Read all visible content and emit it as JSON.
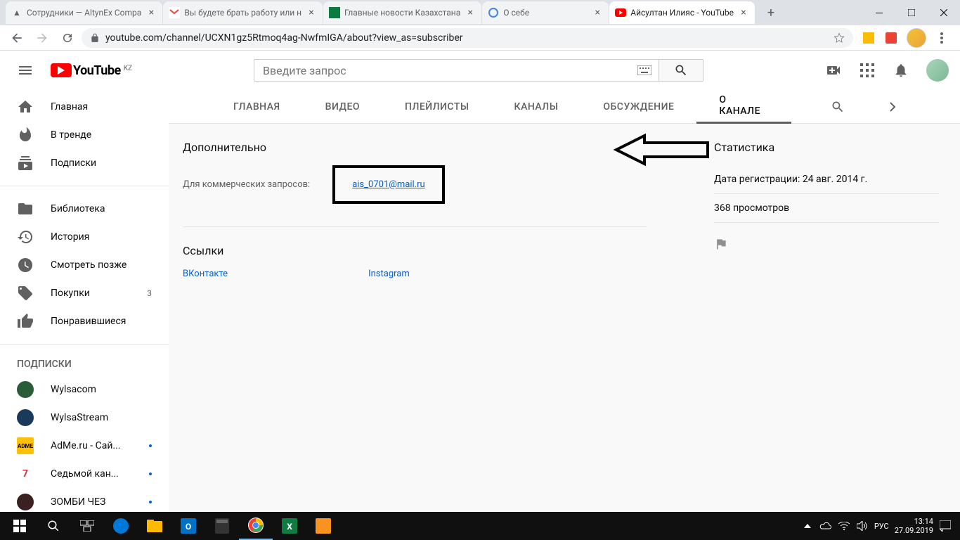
{
  "browser": {
    "tabs": [
      {
        "title": "Сотрудники — AltynEx Compa"
      },
      {
        "title": "Вы будете брать работу или н"
      },
      {
        "title": "Главные новости Казахстана"
      },
      {
        "title": "О себе"
      },
      {
        "title": "Айсултан Илияс - YouTube"
      }
    ],
    "url": "youtube.com/channel/UCXN1gz5Rtmoq4ag-NwfmIGA/about?view_as=subscriber"
  },
  "yt": {
    "search_placeholder": "Введите запрос",
    "logo_text": "YouTube",
    "logo_region": "KZ"
  },
  "sidebar": {
    "items": [
      {
        "label": "Главная"
      },
      {
        "label": "В тренде"
      },
      {
        "label": "Подписки"
      },
      {
        "label": "Библиотека"
      },
      {
        "label": "История"
      },
      {
        "label": "Смотреть позже"
      },
      {
        "label": "Покупки",
        "badge": "3"
      },
      {
        "label": "Понравившиеся"
      }
    ],
    "subs_heading": "ПОДПИСКИ",
    "channels": [
      {
        "label": "Wylsacom",
        "color": "#2a5c3a"
      },
      {
        "label": "WylsaStream",
        "color": "#1a3a5c"
      },
      {
        "label": "AdMe.ru - Сай...",
        "color": "#ffc107",
        "dot": true
      },
      {
        "label": "Седьмой кан...",
        "color": "#d32f2f",
        "dot": true
      },
      {
        "label": "ЗОМБИ ЧЕЗ",
        "color": "#3a2020",
        "dot": true
      }
    ]
  },
  "channel_tabs": [
    "ГЛАВНАЯ",
    "ВИДЕО",
    "ПЛЕЙЛИСТЫ",
    "КАНАЛЫ",
    "ОБСУЖДЕНИЕ",
    "О КАНАЛЕ"
  ],
  "about": {
    "more_heading": "Дополнительно",
    "business_label": "Для коммерческих запросов:",
    "email": "ais_0701@mail.ru",
    "links_heading": "Ссылки",
    "links": [
      "ВКонтакте",
      "Instagram"
    ],
    "stats_heading": "Статистика",
    "join_date": "Дата регистрации: 24 авг. 2014 г.",
    "views": "368 просмотров"
  },
  "taskbar": {
    "lang": "РУС",
    "time": "13:14",
    "date": "27.09.2019"
  }
}
